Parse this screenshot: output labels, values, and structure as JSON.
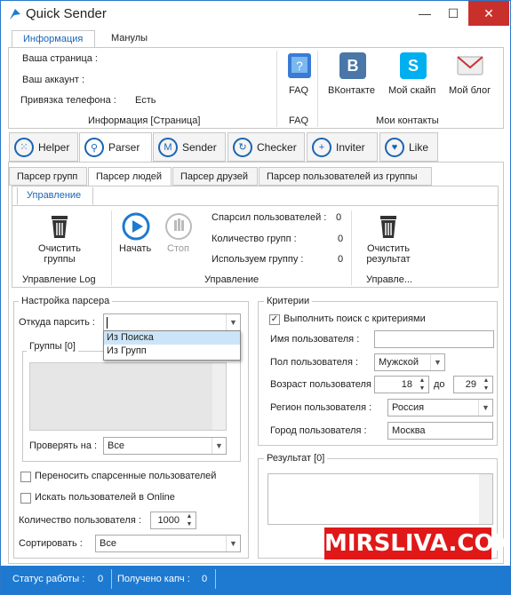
{
  "window": {
    "title": "Quick Sender",
    "minimize": "—",
    "maximize": "☐",
    "close": "✕"
  },
  "top_tabs": {
    "info": "Информация",
    "manuals": "Манулы"
  },
  "info": {
    "page_label": "Ваша страница :",
    "account_label": "Ваш аккаунт :",
    "phone_label": "Привязка телефона :",
    "phone_value": "Есть",
    "footer": "Информация [Страница]"
  },
  "faq": {
    "label": "FAQ",
    "footer": "FAQ"
  },
  "contacts": {
    "vk": "ВКонтакте",
    "skype": "Мой скайп",
    "blog": "Мой блог",
    "footer": "Мои контакты"
  },
  "main_tabs": [
    {
      "label": "Helper",
      "icon": "grid-icon"
    },
    {
      "label": "Parser",
      "icon": "search-icon"
    },
    {
      "label": "Sender",
      "icon": "mail-icon"
    },
    {
      "label": "Checker",
      "icon": "refresh-icon"
    },
    {
      "label": "Inviter",
      "icon": "plus-icon"
    },
    {
      "label": "Like",
      "icon": "heart-icon"
    }
  ],
  "sub_tabs": [
    "Парсер групп",
    "Парсер людей",
    "Парсер друзей",
    "Парсер пользователей из группы"
  ],
  "ribbon": {
    "tab": "Управление",
    "clear_log": "Очистить\nгруппы",
    "clear_log_l1": "Очистить",
    "clear_log_l2": "группы",
    "log_footer": "Управление Log",
    "start": "Начать",
    "stop": "Стоп",
    "control_footer": "Управление",
    "parsed_label": "Спарсил пользователей :",
    "parsed_value": "0",
    "groups_count_label": "Количество групп :",
    "groups_count_value": "0",
    "using_group_label": "Используем группу :",
    "using_group_value": "0",
    "clear_result_l1": "Очистить",
    "clear_result_l2": "результат",
    "result_footer": "Управле..."
  },
  "settings": {
    "title": "Настройка парсера",
    "from_label": "Откуда парсить :",
    "from_value": "",
    "from_options": [
      "Из Поиска",
      "Из Групп"
    ],
    "groups_title": "Группы [0]",
    "check_label": "Проверять на :",
    "check_value": "Все",
    "transfer_label": "Переносить спарсенные пользователей",
    "online_label": "Искать пользователей в Online",
    "count_label": "Количество пользователя :",
    "count_value": "1000",
    "sort_label": "Сортировать :",
    "sort_value": "Все"
  },
  "criteria": {
    "title": "Критерии",
    "enable_label": "Выполнить поиск с критериями",
    "enable_checked": "✓",
    "name_label": "Имя пользователя :",
    "name_value": "",
    "gender_label": "Пол пользователя :",
    "gender_value": "Мужской",
    "age_label": "Возраст пользователя :",
    "age_from": "18",
    "age_to_label": "до",
    "age_to": "29",
    "region_label": "Регион пользователя :",
    "region_value": "Россия",
    "city_label": "Город пользователя :",
    "city_value": "Москва"
  },
  "result": {
    "title": "Результат [0]"
  },
  "status": {
    "work_label": "Статус работы :",
    "work_value": "0",
    "captcha_label": "Получено капч :",
    "captcha_value": "0"
  },
  "watermark": "MIRSLIVA.COM",
  "colors": {
    "accent": "#1e7ad0",
    "vk": "#4a76a8",
    "skype": "#00aff0",
    "close": "#c9302c",
    "watermark": "#e01818"
  }
}
